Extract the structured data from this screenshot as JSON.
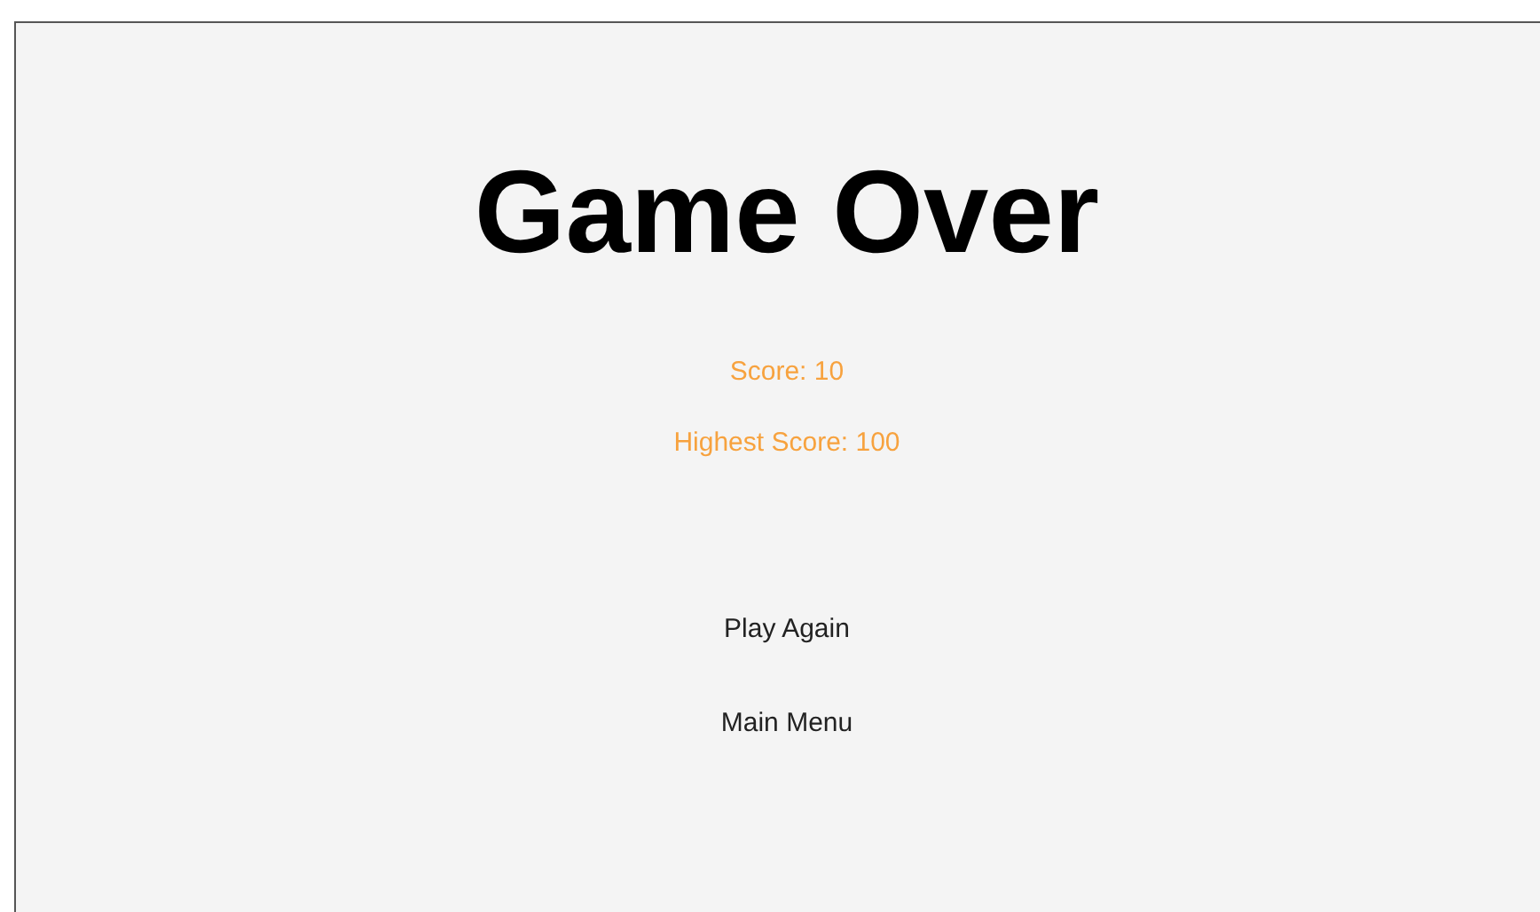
{
  "title": "Game Over",
  "scores": [
    {
      "label": "Score: 10"
    },
    {
      "label": "Highest Score: 100"
    }
  ],
  "buttons": [
    {
      "label": "Play Again"
    },
    {
      "label": "Main Menu"
    }
  ]
}
